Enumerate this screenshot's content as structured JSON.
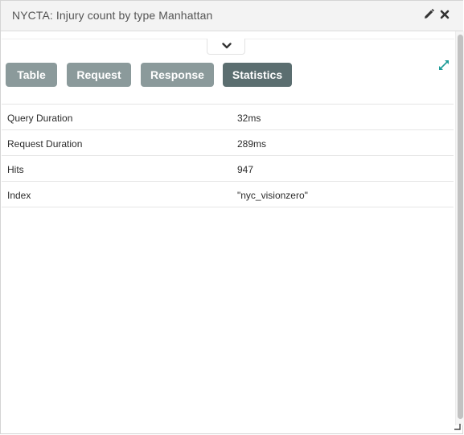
{
  "header": {
    "title": "NYCTA: Injury count by type Manhattan"
  },
  "icons": {
    "edit": "pencil-icon",
    "close": "close-icon",
    "collapse": "chevron-down-icon",
    "expand": "expand-icon"
  },
  "tabs": [
    {
      "label": "Table",
      "active": false
    },
    {
      "label": "Request",
      "active": false
    },
    {
      "label": "Response",
      "active": false
    },
    {
      "label": "Statistics",
      "active": true
    }
  ],
  "stats": [
    {
      "key": "Query Duration",
      "value": "32ms"
    },
    {
      "key": "Request Duration",
      "value": "289ms"
    },
    {
      "key": "Hits",
      "value": "947"
    },
    {
      "key": "Index",
      "value": "\"nyc_visionzero\""
    }
  ],
  "colors": {
    "button": "#8b9a9b",
    "button_active": "#5b6e70",
    "accent": "#1e9c98"
  }
}
